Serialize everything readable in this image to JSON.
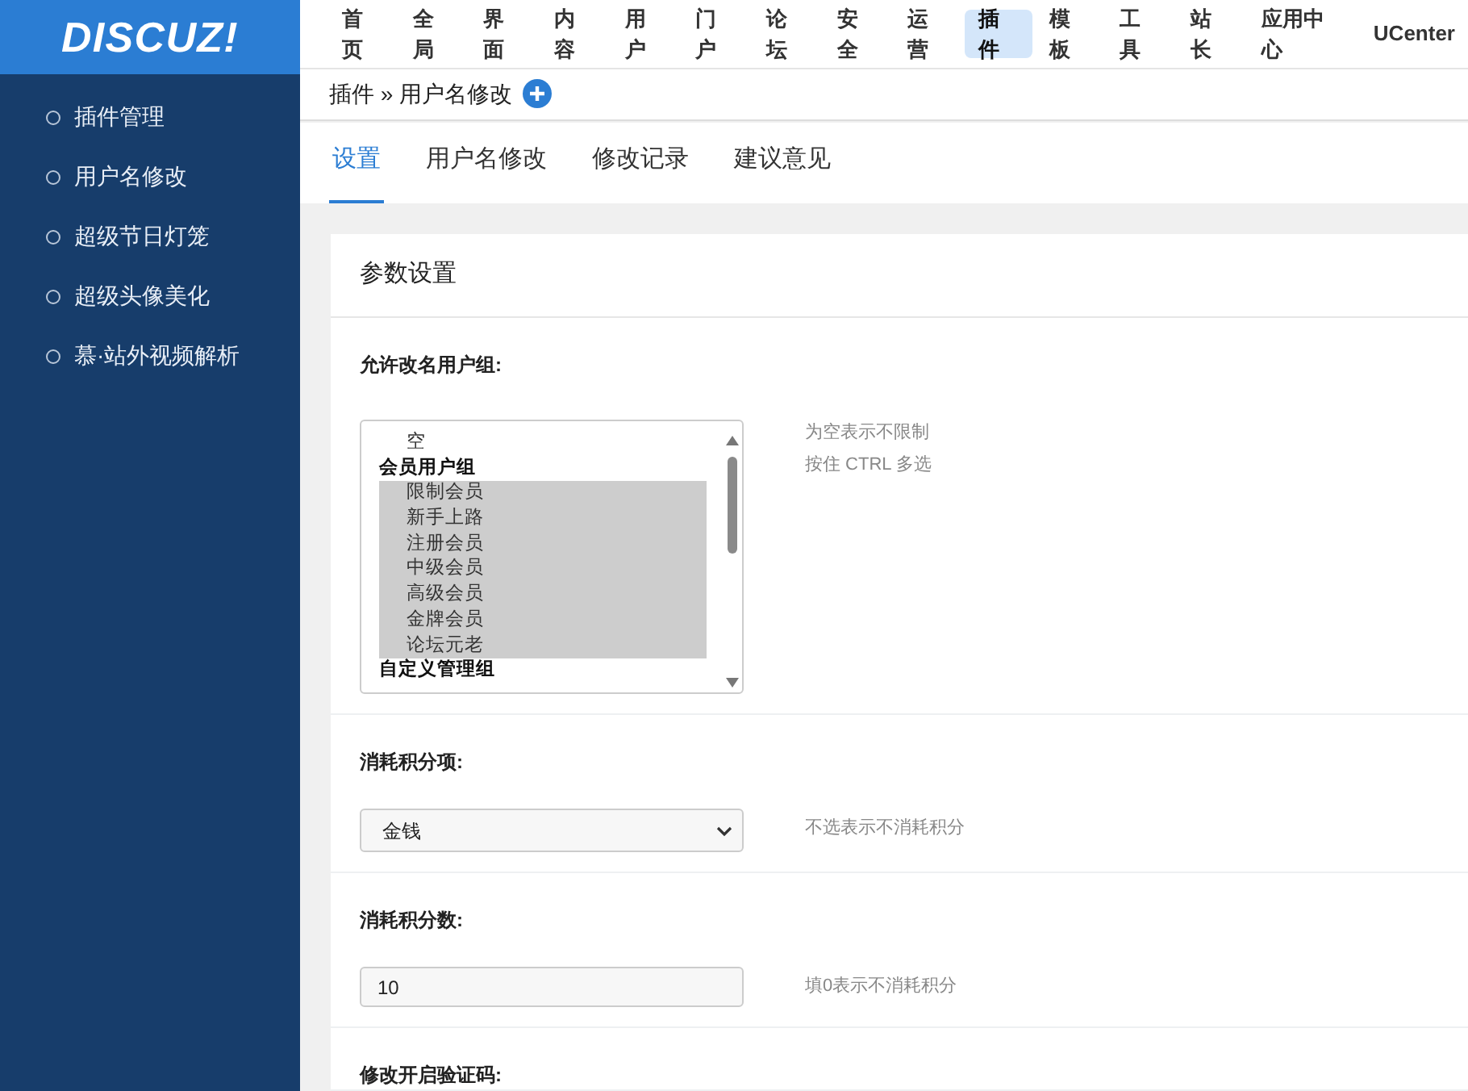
{
  "logo": "DISCUZ!",
  "top_nav": [
    {
      "label": "首页",
      "selected": false
    },
    {
      "label": "全局",
      "selected": false
    },
    {
      "label": "界面",
      "selected": false
    },
    {
      "label": "内容",
      "selected": false
    },
    {
      "label": "用户",
      "selected": false
    },
    {
      "label": "门户",
      "selected": false
    },
    {
      "label": "论坛",
      "selected": false
    },
    {
      "label": "安全",
      "selected": false
    },
    {
      "label": "运营",
      "selected": false
    },
    {
      "label": "插件",
      "selected": true
    },
    {
      "label": "模板",
      "selected": false
    },
    {
      "label": "工具",
      "selected": false
    },
    {
      "label": "站长",
      "selected": false
    },
    {
      "label": "应用中心",
      "selected": false
    },
    {
      "label": "UCenter",
      "selected": false
    }
  ],
  "sidebar": {
    "items": [
      "插件管理",
      "用户名修改",
      "超级节日灯笼",
      "超级头像美化",
      "慕·站外视频解析"
    ]
  },
  "breadcrumb": "插件 » 用户名修改",
  "tabs": [
    {
      "label": "设置",
      "selected": true
    },
    {
      "label": "用户名修改",
      "selected": false
    },
    {
      "label": "修改记录",
      "selected": false
    },
    {
      "label": "建议意见",
      "selected": false
    }
  ],
  "panel_title": "参数设置",
  "settings": [
    {
      "kind": "listbox",
      "label": "允许改名用户组:",
      "hints": [
        "为空表示不限制",
        "按住 CTRL 多选"
      ],
      "options": [
        {
          "kind": "option",
          "label": "空",
          "selected": false
        },
        {
          "kind": "group",
          "label": "会员用户组",
          "selected": false
        },
        {
          "kind": "option",
          "label": "限制会员",
          "selected": true
        },
        {
          "kind": "option",
          "label": "新手上路",
          "selected": true
        },
        {
          "kind": "option",
          "label": "注册会员",
          "selected": true
        },
        {
          "kind": "option",
          "label": "中级会员",
          "selected": true
        },
        {
          "kind": "option",
          "label": "高级会员",
          "selected": true
        },
        {
          "kind": "option",
          "label": "金牌会员",
          "selected": true
        },
        {
          "kind": "option",
          "label": "论坛元老",
          "selected": true
        },
        {
          "kind": "group",
          "label": "自定义管理组",
          "selected": false
        }
      ]
    },
    {
      "kind": "select",
      "label": "消耗积分项:",
      "value": "金钱",
      "hints": [
        "不选表示不消耗积分"
      ]
    },
    {
      "kind": "text",
      "label": "消耗积分数:",
      "value": "10",
      "hints": [
        "填0表示不消耗积分"
      ]
    },
    {
      "kind": "heading",
      "label": "修改开启验证码:"
    }
  ]
}
